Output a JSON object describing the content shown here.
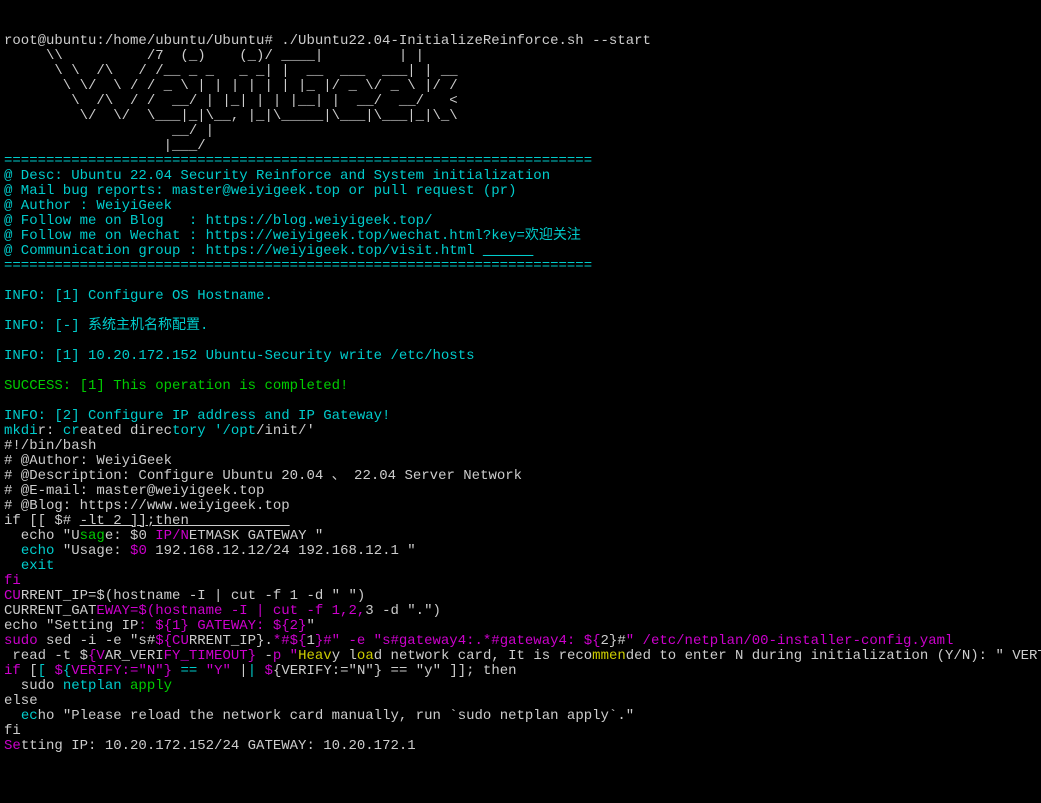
{
  "prompt": "root@ubuntu:/home/ubuntu/Ubuntu# ./Ubuntu22.04-InitializeReinforce.sh --start",
  "ascii": [
    "     \\\\          /7  (_)    (_)/ ____|         | |",
    "      \\ \\  /\\   / /__ _ _   _ _| |  __  ___  ___| | __",
    "       \\ \\/  \\ / / _ \\ | | | | | | |_ |/ _ \\/ _ \\ |/ /",
    "        \\  /\\  / /  __/ | |_| | | |__| |  __/  __/   <",
    "         \\/  \\/  \\___|_|\\__, |_|\\_____|\\___|\\___|_|\\_\\",
    "                    __/ |",
    "                   |___/"
  ],
  "divider": "======================================================================",
  "hdr": {
    "desc": "@ Desc: Ubuntu 22.04 Security Reinforce and System initialization",
    "mail": "@ Mail bug reports: master@weiyigeek.top or pull request (pr)",
    "author": "@ Author : WeiyiGeek",
    "blog": "@ Follow me on Blog   : https://blog.weiyigeek.top/",
    "wechat": "@ Follow me on Wechat : https://weiyigeek.top/wechat.html?key=欢迎关注",
    "comm_pre": "@ Communication group : https://weiyigeek.top/visit.html ",
    "comm_tail": "______"
  },
  "msgs": {
    "i1": "INFO: [1] Configure OS Hostname.",
    "i2": "INFO: [-] 系统主机名称配置.",
    "i3": "INFO: [1] 10.20.172.152 Ubuntu-Security write /etc/hosts",
    "s1": "SUCCESS: [1] This operation is completed!",
    "i4": "INFO: [2] Configure IP address and IP Gateway!"
  },
  "mk": {
    "a": "mkdi",
    "b": "r: ",
    "c": "cr",
    "d": "eated direc",
    "e": "tory '/opt",
    "f": "/init/'"
  },
  "sh": {
    "l1": "#!/bin/bash",
    "l2": "# @Author: WeiyiGeek",
    "l3": "# @Description: Configure Ubuntu 20.04 、 22.04 Server Network",
    "l4": "# @E-mail: master@weiyigeek.top",
    "l5": "# @Blog: https://www.weiyigeek.top"
  },
  "ifln": {
    "a": "if [[ $# ",
    "b": "-lt 2 ]];then            "
  },
  "u1": {
    "a": "  echo \"U",
    "b": "sag",
    "c": "e: $0 ",
    "d": "IP/N",
    "e": "ETMASK GATEWAY \""
  },
  "u2": {
    "a": "  ",
    "b": "echo",
    "c": " \"Usage: ",
    "d": "$0",
    "e": " 192.168.12.12/24 192.168.12.1 \""
  },
  "ex": {
    "a": "  ",
    "b": "exit"
  },
  "fi1": "fi",
  "ci": {
    "a": "CU",
    "b": "RRENT_IP=$(hostname -I | cut -f 1 -d \" \")"
  },
  "cg": {
    "a": "CURRENT_GAT",
    "b": "EWAY=$(hostname -I | cut -f 1,2,",
    "c": "3 -d \".\")"
  },
  "es": {
    "a": "echo \"Setting IP",
    "b": ": ${1} GATEWAY: ${2}",
    "c": "\""
  },
  "sed": {
    "a": "sudo",
    "b": " sed -i -e \"s#",
    "c": "${CU",
    "d": "RRENT_IP}.",
    "e": "*#${",
    "f": "1",
    "g": "}#\" -e \"s#gateway4:.*#gateway4: ${",
    "h": "2}#",
    "i": "\" /etc/netplan/00-installer-config.yaml"
  },
  "rd": {
    "a": " read -t $",
    "b": "{V",
    "c": "AR_VERI",
    "d": "FY_TIMEOUT}",
    "e": " -",
    "f": "p \"",
    "g": "Heav",
    "h": "y l",
    "i": "oa",
    "j": "d network card, It is reco",
    "k": "mmen",
    "l": "ded to enter N during initialization (Y/N): \" VERTIFY"
  },
  "if2": {
    "a": "if",
    "b": " [",
    "c": "[ ",
    "d": "$",
    "e": "{",
    "f": "VERIFY:=\"N\"}",
    "g": " == ",
    "h": "\"Y\"",
    "i": " |",
    "j": "| ",
    "k": "$",
    "l": "{VERIFY:=\"N\"} == \"y\" ]]; then"
  },
  "np": {
    "a": "  sudo ",
    "b": "netplan",
    "c": " ",
    "d": "apply"
  },
  "els": "else",
  "el": {
    "a": "  ",
    "b": "ec",
    "c": "ho \"Please reload the network card manually, run `sudo netplan apply`.\""
  },
  "fi2": "fi",
  "set": {
    "a": "Se",
    "b": "tting IP: 10.20.172.152/24 GATEWAY: 10.20.172.1"
  }
}
